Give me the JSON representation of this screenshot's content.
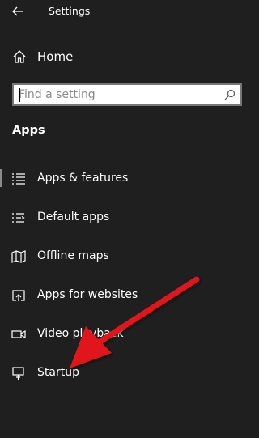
{
  "window": {
    "title": "Settings"
  },
  "nav": {
    "home_label": "Home"
  },
  "search": {
    "placeholder": "Find a setting"
  },
  "section": {
    "title": "Apps"
  },
  "items": [
    {
      "label": "Apps & features",
      "icon": "list-icon",
      "selected": true
    },
    {
      "label": "Default apps",
      "icon": "default-apps-icon",
      "selected": false
    },
    {
      "label": "Offline maps",
      "icon": "map-icon",
      "selected": false
    },
    {
      "label": "Apps for websites",
      "icon": "open-in-app-icon",
      "selected": false
    },
    {
      "label": "Video playback",
      "icon": "video-icon",
      "selected": false
    },
    {
      "label": "Startup",
      "icon": "startup-icon",
      "selected": false
    }
  ],
  "colors": {
    "background": "#1f1f1f",
    "text": "#ffffff",
    "annotation_arrow": "#e0141c"
  }
}
